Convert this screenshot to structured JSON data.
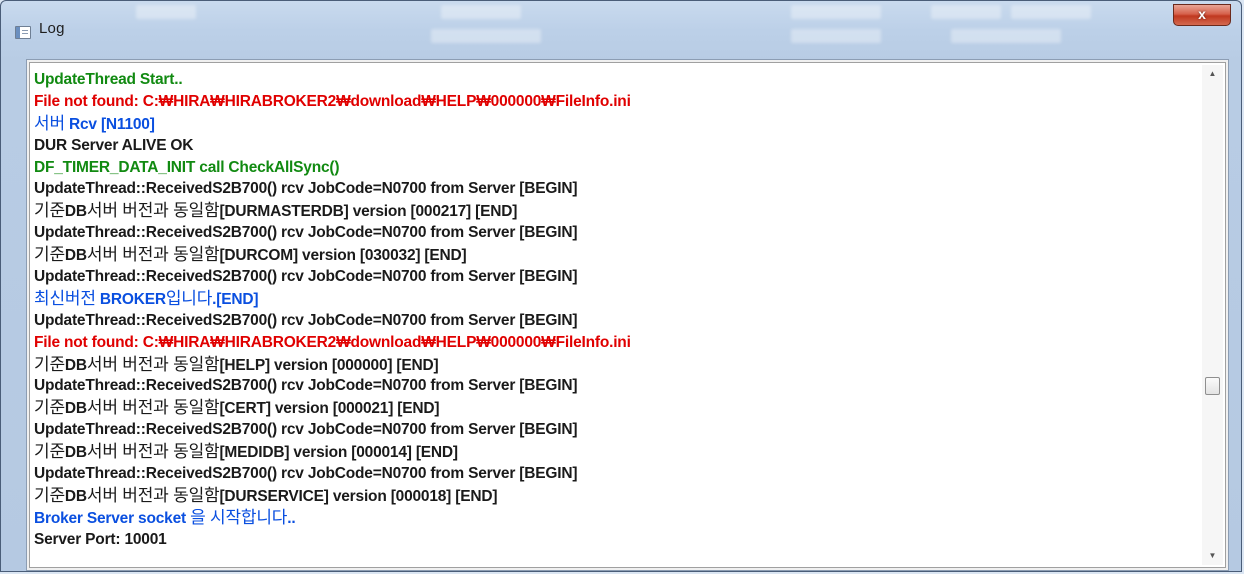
{
  "window": {
    "title": "Log",
    "close_label": "x"
  },
  "log": {
    "lines": [
      {
        "text": "UpdateThread Start..",
        "color": "green"
      },
      {
        "text": "File not found: C:₩HIRA₩HIRABROKER2₩download₩HELP₩000000₩FileInfo.ini",
        "color": "red"
      },
      {
        "text": "서버 Rcv [N1100]",
        "color": "blue"
      },
      {
        "text": "DUR Server ALIVE OK",
        "color": "black"
      },
      {
        "text": "DF_TIMER_DATA_INIT call CheckAllSync()",
        "color": "green"
      },
      {
        "text": "UpdateThread::ReceivedS2B700() rcv JobCode=N0700 from Server [BEGIN]",
        "color": "black"
      },
      {
        "text": "기준DB서버 버전과 동일함[DURMASTERDB] version [000217] [END]",
        "color": "black"
      },
      {
        "text": "UpdateThread::ReceivedS2B700() rcv JobCode=N0700 from Server [BEGIN]",
        "color": "black"
      },
      {
        "text": "기준DB서버 버전과 동일함[DURCOM] version [030032] [END]",
        "color": "black"
      },
      {
        "text": "UpdateThread::ReceivedS2B700() rcv JobCode=N0700 from Server [BEGIN]",
        "color": "black"
      },
      {
        "text": "최신버전 BROKER입니다.[END]",
        "color": "blue"
      },
      {
        "text": "UpdateThread::ReceivedS2B700() rcv JobCode=N0700 from Server [BEGIN]",
        "color": "black"
      },
      {
        "text": "File not found: C:₩HIRA₩HIRABROKER2₩download₩HELP₩000000₩FileInfo.ini",
        "color": "red"
      },
      {
        "text": "기준DB서버 버전과 동일함[HELP] version [000000] [END]",
        "color": "black"
      },
      {
        "text": "UpdateThread::ReceivedS2B700() rcv JobCode=N0700 from Server [BEGIN]",
        "color": "black"
      },
      {
        "text": "기준DB서버 버전과 동일함[CERT] version [000021] [END]",
        "color": "black"
      },
      {
        "text": "UpdateThread::ReceivedS2B700() rcv JobCode=N0700 from Server [BEGIN]",
        "color": "black"
      },
      {
        "text": "기준DB서버 버전과 동일함[MEDIDB] version [000014] [END]",
        "color": "black"
      },
      {
        "text": "UpdateThread::ReceivedS2B700() rcv JobCode=N0700 from Server [BEGIN]",
        "color": "black"
      },
      {
        "text": "기준DB서버 버전과 동일함[DURSERVICE] version [000018] [END]",
        "color": "black"
      },
      {
        "text": "Broker Server socket 을 시작합니다..",
        "color": "blue"
      },
      {
        "text": "Server Port: 10001",
        "color": "black"
      }
    ]
  },
  "scrollbar": {
    "up_icon": "arrow-up",
    "down_icon": "arrow-down",
    "position_fraction": 0.66
  },
  "colors": {
    "green": "#118a11",
    "red": "#e00000",
    "blue": "#0a4fe0",
    "black": "#1a1a1a"
  }
}
